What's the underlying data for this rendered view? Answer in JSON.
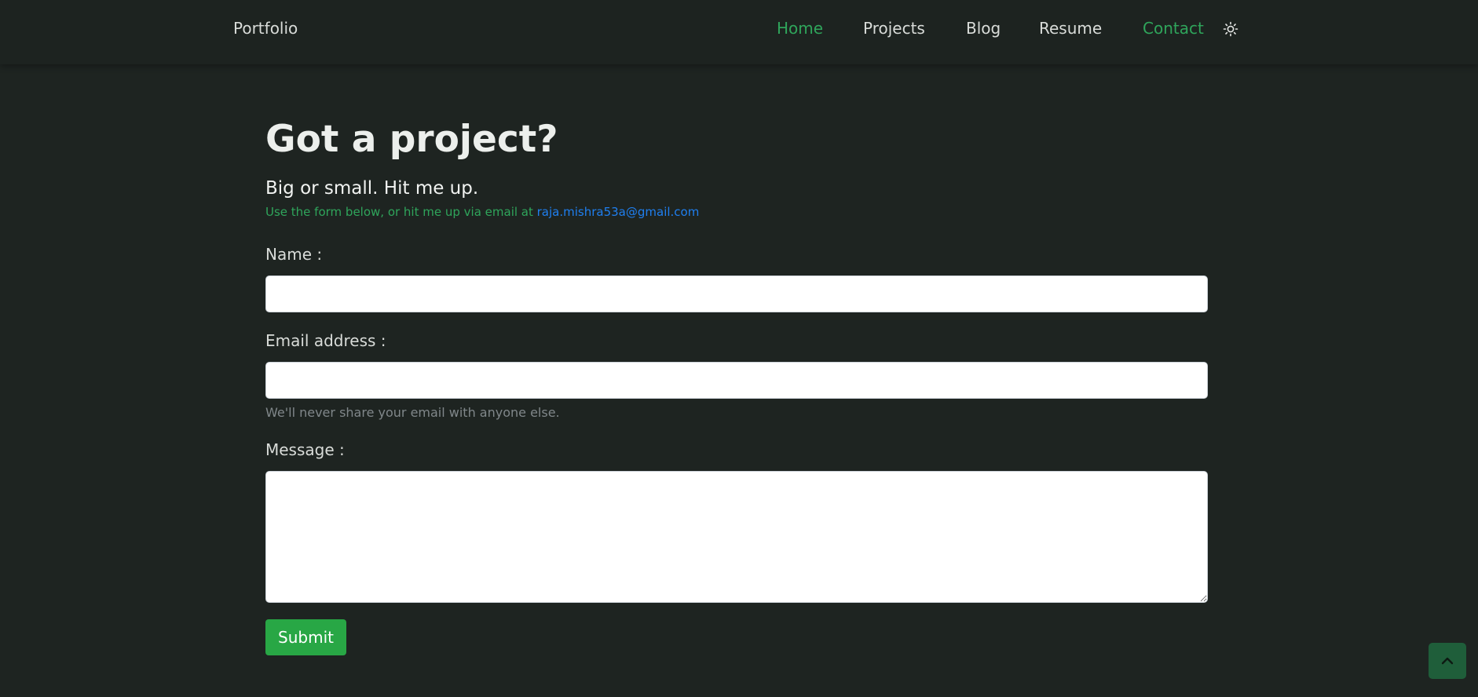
{
  "nav": {
    "brand": "Portfolio",
    "links": [
      {
        "label": "Home",
        "active": true
      },
      {
        "label": "Projects",
        "active": false
      },
      {
        "label": "Blog",
        "active": false
      },
      {
        "label": "Resume",
        "active": false
      },
      {
        "label": "Contact",
        "active": true
      }
    ],
    "theme_toggle_icon": "sun-icon"
  },
  "hero": {
    "title": "Got a project?",
    "subtitle": "Big or small. Hit me up.",
    "note_text": "Use the form below, or hit me up via email at ",
    "email": "raja.mishra53a@gmail.com"
  },
  "form": {
    "name_label": "Name :",
    "name_value": "",
    "email_label": "Email address :",
    "email_value": "",
    "email_help": "We'll never share your email with anyone else.",
    "message_label": "Message :",
    "message_value": "",
    "submit_label": "Submit"
  },
  "scroll_top_icon": "chevron-up-icon",
  "colors": {
    "background": "#1e2421",
    "accent_green": "#2fa55b",
    "link_blue": "#1f7ff0",
    "button_green": "#28a745"
  }
}
